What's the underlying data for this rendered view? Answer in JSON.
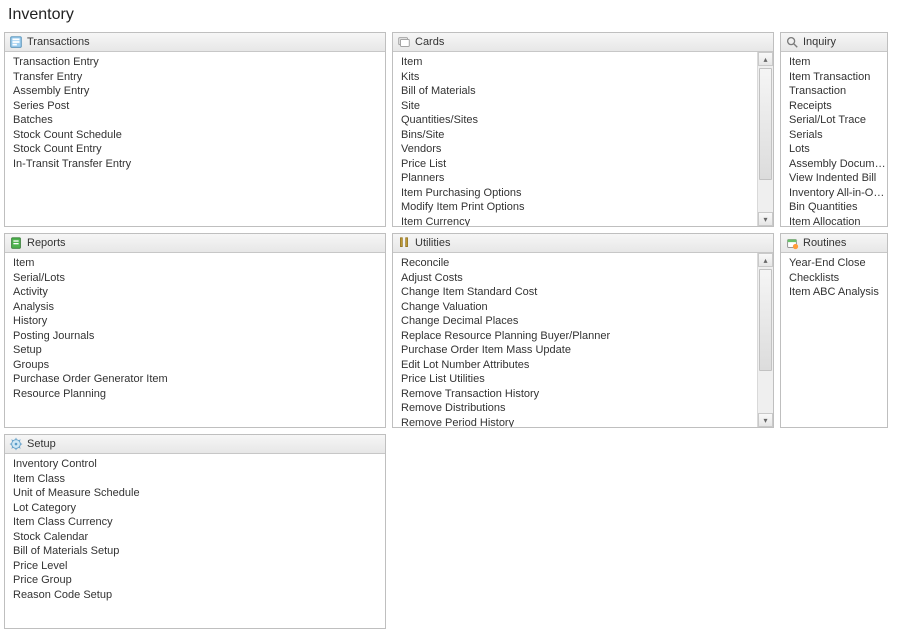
{
  "page_title": "Inventory",
  "panels": {
    "transactions": {
      "title": "Transactions",
      "items": [
        "Transaction Entry",
        "Transfer Entry",
        "Assembly Entry",
        "Series Post",
        "Batches",
        "Stock Count Schedule",
        "Stock Count Entry",
        "In-Transit Transfer Entry"
      ]
    },
    "cards": {
      "title": "Cards",
      "items": [
        "Item",
        "Kits",
        "Bill of Materials",
        "Site",
        "Quantities/Sites",
        "Bins/Site",
        "Vendors",
        "Price List",
        "Planners",
        "Item Purchasing Options",
        "Modify Item Print Options",
        "Item Currency"
      ]
    },
    "inquiry": {
      "title": "Inquiry",
      "items": [
        "Item",
        "Item Transaction",
        "Transaction",
        "Receipts",
        "Serial/Lot Trace",
        "Serials",
        "Lots",
        "Assembly Documents",
        "View Indented Bill",
        "Inventory All-in-One View",
        "Bin Quantities",
        "Item Allocation"
      ]
    },
    "reports": {
      "title": "Reports",
      "items": [
        "Item",
        "Serial/Lots",
        "Activity",
        "Analysis",
        "History",
        "Posting Journals",
        "Setup",
        "Groups",
        "Purchase Order Generator Item",
        "Resource Planning"
      ]
    },
    "utilities": {
      "title": "Utilities",
      "items": [
        "Reconcile",
        "Adjust Costs",
        "Change Item Standard Cost",
        "Change Valuation",
        "Change Decimal Places",
        "Replace Resource Planning Buyer/Planner",
        "Purchase Order Item Mass Update",
        "Edit Lot Number Attributes",
        "Price List Utilities",
        "Remove Transaction History",
        "Remove Distributions",
        "Remove Period History"
      ]
    },
    "routines": {
      "title": "Routines",
      "items": [
        "Year-End Close",
        "Checklists",
        "Item ABC Analysis"
      ]
    },
    "setup": {
      "title": "Setup",
      "items": [
        "Inventory Control",
        "Item Class",
        "Unit of Measure Schedule",
        "Lot Category",
        "Item Class Currency",
        "Stock Calendar",
        "Bill of Materials Setup",
        "Price Level",
        "Price Group",
        "Reason Code Setup"
      ]
    }
  }
}
